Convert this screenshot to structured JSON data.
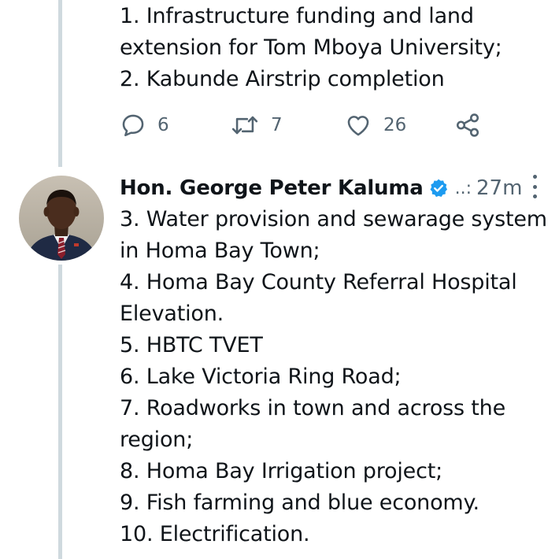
{
  "tweet1": {
    "text": "1. Infrastructure funding and land\nextension for Tom Mboya University;\n2. Kabunde Airstrip completion",
    "actions": {
      "reply_count": "6",
      "retweet_count": "7",
      "like_count": "26"
    }
  },
  "tweet2": {
    "author": {
      "display_name": "Hon. George Peter Kaluma",
      "handle_truncated": "..:",
      "verified": true
    },
    "timestamp": "27m",
    "text": "3. Water provision and sewarage system\nin Homa Bay Town;\n4. Homa Bay County Referral Hospital\nElevation.\n5. HBTC TVET\n6. Lake Victoria Ring Road;\n7. Roadworks in town and across the\nregion;\n8. Homa Bay Irrigation project;\n9. Fish farming and blue economy.\n10. Electrification."
  },
  "icons": {
    "reply": "reply-icon",
    "retweet": "retweet-icon",
    "like": "heart-icon",
    "share": "share-icon",
    "verified": "verified-badge-icon",
    "more": "more-options-icon"
  },
  "colors": {
    "text": "#0f1419",
    "secondary": "#536471",
    "thread_line": "#cfd9de",
    "verified": "#1d9bf0"
  }
}
